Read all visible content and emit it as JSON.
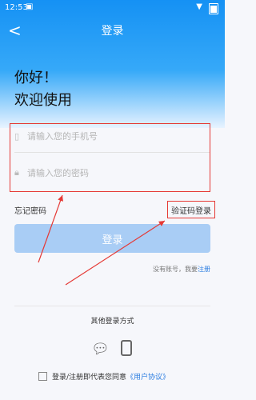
{
  "status": {
    "time": "12:53"
  },
  "topbar": {
    "back": "<",
    "title": "登录"
  },
  "welcome": {
    "line1": "你好！",
    "line2": "欢迎使用"
  },
  "form": {
    "phone_placeholder": "请输入您的手机号",
    "password_placeholder": "请输入您的密码",
    "forgot": "忘记密码",
    "sms_login": "验证码登录",
    "login_button": "登录"
  },
  "register": {
    "text": "没有账号，我要",
    "link": "注册"
  },
  "other_login": {
    "title": "其他登录方式"
  },
  "agreement": {
    "text": "登录/注册即代表您同意",
    "link": "《用户协议》"
  },
  "colors": {
    "accent": "#1591f4",
    "annotation_red": "#e53935"
  }
}
